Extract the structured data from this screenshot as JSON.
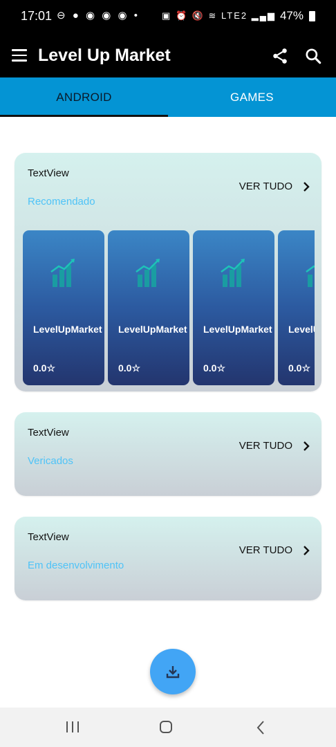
{
  "status_bar": {
    "time": "17:01",
    "left_icons": "⊖ ● ◉ ◉ ◉ •",
    "right_icons": "▣ ⏰ 🔇 ≋ LTE2 ▂▄▆",
    "battery": "47%"
  },
  "app_bar": {
    "title": "Level Up Market",
    "icons": [
      "menu-icon",
      "share-icon",
      "search-icon"
    ]
  },
  "tabs": [
    {
      "label": "ANDROID",
      "selected": true
    },
    {
      "label": "GAMES",
      "selected": false
    }
  ],
  "colors": {
    "tab_bar": "#0494d4",
    "accent_text": "#4fc3f7",
    "fab": "#42a5f5",
    "card_gradient_top": "#d5f1ee",
    "card_gradient_bottom": "#c9cfd6",
    "app_card_top": "#3b86c6",
    "app_card_bottom": "#23356e"
  },
  "sections": [
    {
      "title": "TextView",
      "subtitle": "Recomendado",
      "see_all": "VER TUDO",
      "apps": [
        {
          "name": "LevelUpMarket",
          "rating": "0.0☆"
        },
        {
          "name": "LevelUpMarket",
          "rating": "0.0☆"
        },
        {
          "name": "LevelUpMarket",
          "rating": "0.0☆"
        },
        {
          "name": "LevelUpMarket",
          "rating": "0.0☆"
        }
      ]
    },
    {
      "title": "TextView",
      "subtitle": "Vericados",
      "see_all": "VER TUDO"
    },
    {
      "title": "TextView",
      "subtitle": "Em desenvolvimento",
      "see_all": "VER TUDO"
    }
  ],
  "fab": {
    "icon": "download-icon"
  },
  "nav_bar": {
    "icons": [
      "recent-apps-icon",
      "home-icon",
      "back-icon"
    ]
  }
}
